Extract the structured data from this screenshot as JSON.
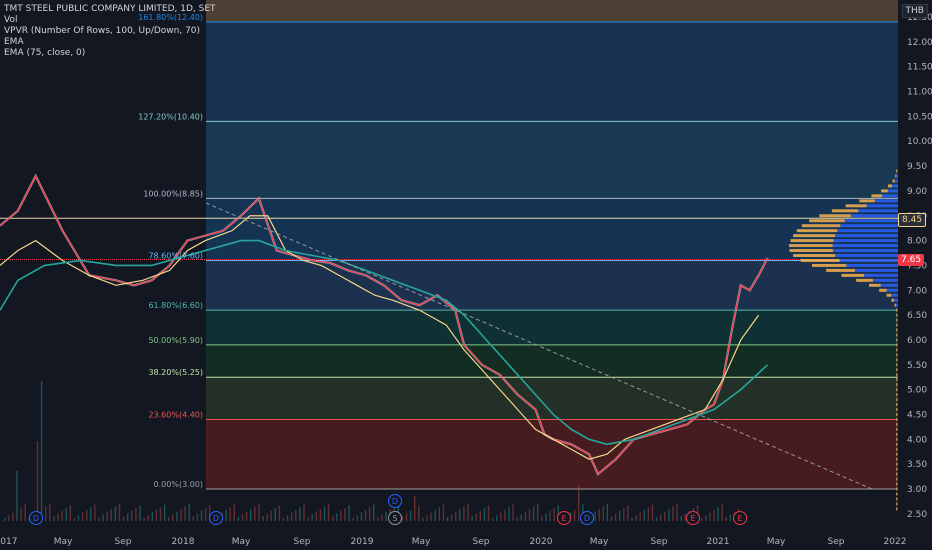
{
  "legend": {
    "title": "TMT STEEL PUBLIC COMPANY LIMITED, 1D, SET",
    "line2": "Vol",
    "line3": "VPVR (Number Of Rows, 100, Up/Down, 70)",
    "line4": "EMA",
    "line5": "EMA (75, close, 0)"
  },
  "currency": "THB",
  "price_tags": {
    "upper": "8.45",
    "last": "7.65"
  },
  "colors": {
    "background": "#131722",
    "fib_161": "#1e3a5f",
    "fib_127": "#1b4560",
    "fib_100": "#173d63",
    "fib_786": "#1f3b5c",
    "fib_618": "#0f3b3b",
    "fib_50": "#143524",
    "fib_382": "#2a3a2a",
    "fib_236": "#5a1f22",
    "above_161": "#5c4a3a",
    "ema_fast": "#f23645",
    "ema_mid": "#f5d78a",
    "ema_slow": "#26a69a",
    "candle": "#c9d1d9",
    "trendline": "#9598a1",
    "vpvr_up": "#2962ff",
    "vpvr_down": "#f7b24c",
    "volume": "#5d4037"
  },
  "chart_data": {
    "type": "line",
    "title": "TMT STEEL PUBLIC COMPANY LIMITED, 1D, SET",
    "ylabel": "",
    "ylim": [
      2.3,
      12.9
    ],
    "x_ticks": [
      "2017",
      "May",
      "Sep",
      "2018",
      "May",
      "Sep",
      "2019",
      "May",
      "Sep",
      "2020",
      "May",
      "Sep",
      "2021",
      "May",
      "Sep",
      "2022"
    ],
    "y_ticks": [
      2.5,
      3.0,
      3.5,
      4.0,
      4.5,
      5.0,
      5.5,
      6.0,
      6.5,
      7.0,
      7.5,
      8.0,
      8.5,
      9.0,
      9.5,
      10.0,
      10.5,
      11.0,
      11.5,
      12.0,
      12.5
    ],
    "fib_levels": [
      {
        "label": "161.80%(12.40)",
        "value": 12.4,
        "color": "#1e88e5"
      },
      {
        "label": "127.20%(10.40)",
        "value": 10.4,
        "color": "#80cbc4"
      },
      {
        "label": "100.00%(8.85)",
        "value": 8.85,
        "color": "#b0b8c8"
      },
      {
        "label": "78.60%(7.60)",
        "value": 7.6,
        "color": "#64b5f6"
      },
      {
        "label": "61.80%(6.60)",
        "value": 6.6,
        "color": "#4db6ac"
      },
      {
        "label": "50.00%(5.90)",
        "value": 5.9,
        "color": "#81c784"
      },
      {
        "label": "38.20%(5.25)",
        "value": 5.25,
        "color": "#c5e1a5"
      },
      {
        "label": "23.60%(4.40)",
        "value": 4.4,
        "color": "#ef5350"
      },
      {
        "label": "0.00%(3.00)",
        "value": 3.0,
        "color": "#9e9e9e"
      }
    ],
    "horizontal_line": 8.45,
    "series": [
      {
        "values": [
          8.3,
          8.6,
          9.3,
          8.2,
          7.3,
          7.2,
          7.1,
          7.2,
          7.5,
          8.0,
          8.1,
          8.2,
          8.5,
          8.85,
          7.8,
          7.7,
          7.6,
          7.55,
          7.4,
          7.3,
          7.1,
          6.8,
          6.7,
          6.9,
          6.6,
          5.9,
          5.5,
          5.3,
          4.9,
          4.6,
          4.1,
          4.0,
          3.9,
          3.7,
          3.3,
          3.6,
          4.0,
          4.1,
          4.2,
          4.3,
          4.6,
          4.7,
          5.2,
          6.2,
          7.1,
          7.0,
          7.3,
          7.65
        ],
        "x": [
          0.0,
          0.1,
          0.2,
          0.35,
          0.5,
          0.65,
          0.75,
          0.85,
          0.95,
          1.05,
          1.15,
          1.25,
          1.35,
          1.45,
          1.55,
          1.65,
          1.75,
          1.85,
          1.95,
          2.05,
          2.15,
          2.25,
          2.35,
          2.45,
          2.55,
          2.6,
          2.7,
          2.8,
          2.9,
          3.0,
          3.05,
          3.1,
          3.2,
          3.3,
          3.35,
          3.45,
          3.55,
          3.65,
          3.75,
          3.85,
          3.95,
          4.0,
          4.05,
          4.1,
          4.15,
          4.2,
          4.25,
          4.3
        ]
      },
      {
        "values": [
          7.5,
          7.8,
          8.0,
          7.6,
          7.3,
          7.1,
          7.2,
          7.4,
          7.8,
          8.0,
          8.2,
          8.5,
          8.5,
          7.8,
          7.6,
          7.5,
          7.3,
          7.1,
          6.9,
          6.8,
          6.6,
          6.3,
          5.8,
          5.4,
          5.0,
          4.6,
          4.2,
          4.0,
          3.8,
          3.6,
          3.7,
          4.0,
          4.2,
          4.4,
          4.6,
          5.2,
          6.0,
          6.5
        ],
        "x": [
          0.0,
          0.1,
          0.2,
          0.35,
          0.5,
          0.65,
          0.8,
          0.95,
          1.05,
          1.15,
          1.3,
          1.4,
          1.5,
          1.6,
          1.7,
          1.8,
          1.9,
          2.0,
          2.1,
          2.2,
          2.35,
          2.5,
          2.6,
          2.7,
          2.8,
          2.9,
          3.0,
          3.1,
          3.2,
          3.3,
          3.4,
          3.5,
          3.65,
          3.8,
          3.95,
          4.05,
          4.15,
          4.25
        ]
      },
      {
        "values": [
          6.6,
          7.2,
          7.5,
          7.6,
          7.5,
          7.5,
          7.7,
          7.9,
          8.0,
          8.0,
          7.8,
          7.7,
          7.6,
          7.4,
          7.2,
          7.0,
          6.8,
          6.5,
          6.1,
          5.7,
          5.3,
          4.9,
          4.5,
          4.2,
          4.0,
          3.9,
          4.0,
          4.2,
          4.4,
          4.6,
          5.0,
          5.5
        ],
        "x": [
          0.0,
          0.1,
          0.25,
          0.45,
          0.65,
          0.85,
          1.05,
          1.25,
          1.35,
          1.45,
          1.6,
          1.75,
          1.9,
          2.05,
          2.2,
          2.35,
          2.5,
          2.6,
          2.7,
          2.8,
          2.9,
          3.0,
          3.1,
          3.2,
          3.3,
          3.4,
          3.55,
          3.7,
          3.85,
          4.0,
          4.15,
          4.3
        ]
      }
    ],
    "markers": [
      "D",
      "D",
      "D",
      "S",
      "E",
      "D",
      "E",
      "E"
    ]
  }
}
